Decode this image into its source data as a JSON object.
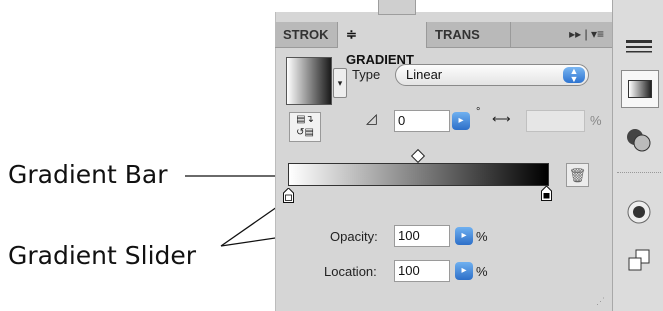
{
  "annotations": {
    "gradient_bar": "Gradient Bar",
    "gradient_slider": "Gradient Slider"
  },
  "panel": {
    "tabs": [
      {
        "label": "STROK",
        "active": false
      },
      {
        "label": "≑ GRADIENT",
        "active": true
      },
      {
        "label": "TRANS",
        "active": false
      }
    ],
    "tab_menu_icons": "▸▸ | ▾≡",
    "type_label": "Type",
    "type_value": "Linear",
    "angle_value": "0",
    "angle_unit": "°",
    "aspect_unit": "%",
    "opacity_label": "Opacity:",
    "opacity_value": "100",
    "opacity_unit": "%",
    "location_label": "Location:",
    "location_value": "100",
    "location_unit": "%"
  },
  "icons": {
    "dropdown": "▾",
    "select_arrows": "▲\n▼",
    "reverse": "▤↻\n↺▤",
    "angle": "◿",
    "aspect": "⟷",
    "trash": "🗑",
    "step": "▸"
  },
  "colors": {
    "panel_bg": "#d6d6d6",
    "accent_blue": "#2e74d0"
  }
}
